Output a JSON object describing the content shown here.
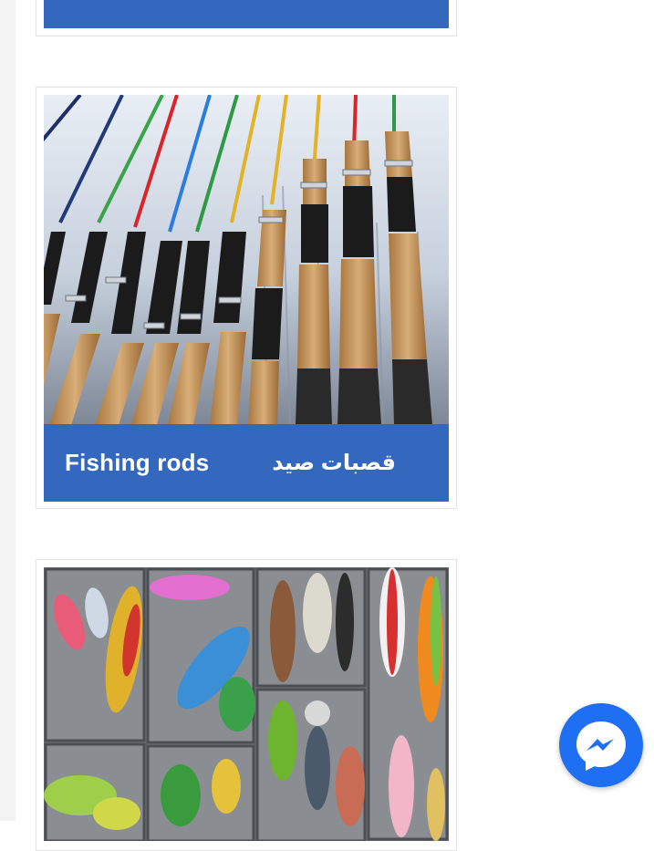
{
  "categories": [
    {
      "label_en": "",
      "label_ar": ""
    },
    {
      "label_en": "Fishing rods",
      "label_ar": "قصبات صيد"
    },
    {
      "label_en": "",
      "label_ar": ""
    }
  ],
  "chat": {
    "icon": "messenger-icon"
  },
  "colors": {
    "banner": "#3468bf",
    "messenger": "#1f6ff2",
    "rail": "#f3f3f3"
  }
}
